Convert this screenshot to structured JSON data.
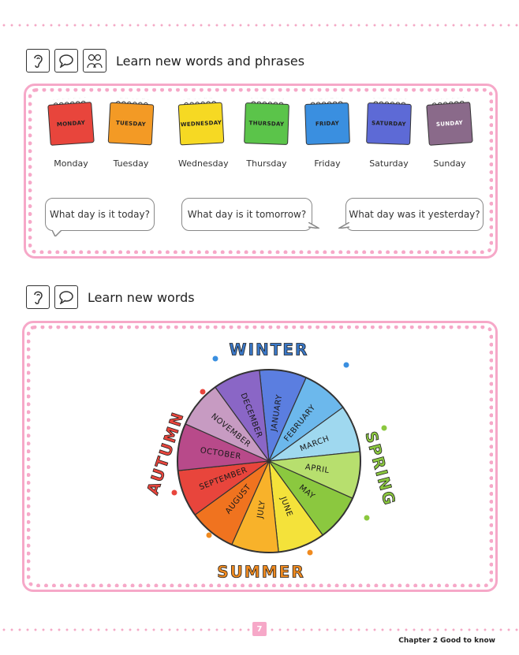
{
  "section1": {
    "title": "Learn new words and phrases",
    "icons": [
      "ear-icon",
      "speech-bubble-icon",
      "people-talking-icon"
    ]
  },
  "days": [
    {
      "note": "MONDAY",
      "label": "Monday",
      "color": "#e8453c"
    },
    {
      "note": "TUESDAY",
      "label": "Tuesday",
      "color": "#f39a25"
    },
    {
      "note": "WEDNESDAY",
      "label": "Wednesday",
      "color": "#f6d923"
    },
    {
      "note": "THURSDAY",
      "label": "Thursday",
      "color": "#5bc44a"
    },
    {
      "note": "FRIDAY",
      "label": "Friday",
      "color": "#3a8fe0"
    },
    {
      "note": "SATURDAY",
      "label": "Saturday",
      "color": "#5d6ad6"
    },
    {
      "note": "SUNDAY",
      "label": "Sunday",
      "color": "#8a6a8a"
    }
  ],
  "bubbles": [
    "What day is it today?",
    "What day is it tomorrow?",
    "What day was it yesterday?"
  ],
  "section2": {
    "title": "Learn new words",
    "icons": [
      "ear-icon",
      "speech-bubble-icon"
    ]
  },
  "wheel": {
    "months": [
      {
        "name": "JANUARY",
        "color": "#5b7ee0"
      },
      {
        "name": "FEBRUARY",
        "color": "#6cb8ec"
      },
      {
        "name": "MARCH",
        "color": "#9fd8ef"
      },
      {
        "name": "APRIL",
        "color": "#b7df6e"
      },
      {
        "name": "MAY",
        "color": "#8bc83f"
      },
      {
        "name": "JUNE",
        "color": "#f4e23a"
      },
      {
        "name": "JULY",
        "color": "#f8b22a"
      },
      {
        "name": "AUGUST",
        "color": "#f0731f"
      },
      {
        "name": "SEPTEMBER",
        "color": "#e8453c"
      },
      {
        "name": "OCTOBER",
        "color": "#b84a8a"
      },
      {
        "name": "NOVEMBER",
        "color": "#c79bc2"
      },
      {
        "name": "DECEMBER",
        "color": "#8a66c6"
      }
    ],
    "seasons": [
      {
        "name": "WINTER",
        "color": "#3a78c8"
      },
      {
        "name": "SPRING",
        "color": "#8bc83f"
      },
      {
        "name": "SUMMER",
        "color": "#f08a1f"
      },
      {
        "name": "AUTUMN",
        "color": "#e8453c"
      }
    ]
  },
  "footer": {
    "page": "7",
    "text": "Chapter 2   Good to know"
  }
}
